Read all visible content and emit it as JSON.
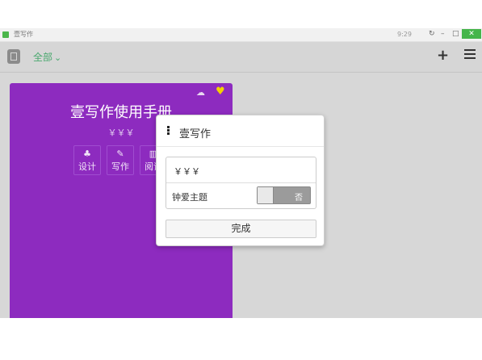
{
  "window": {
    "title": "壹写作",
    "clock": "9:29",
    "refresh_icon": "refresh-icon",
    "minimize": "–",
    "maximize": "□",
    "close": "✕"
  },
  "toolbar": {
    "filter_label": "全部",
    "chevron": "⌄",
    "add_icon": "+",
    "menu_icon": "list-icon"
  },
  "card": {
    "title": "壹写作使用手册",
    "subtitle": "￥￥￥",
    "color": "#8d2bbf",
    "favorite_color": "#f3d200",
    "buttons": [
      {
        "label": "设计",
        "icon": "sitemap-icon"
      },
      {
        "label": "写作",
        "icon": "edit-icon"
      },
      {
        "label": "阅读",
        "icon": "book-icon"
      }
    ]
  },
  "dialog": {
    "title": "壹写作",
    "name_value": "￥￥￥",
    "favorite_label": "钟爱主题",
    "toggle_text": "否",
    "done_label": "完成"
  }
}
